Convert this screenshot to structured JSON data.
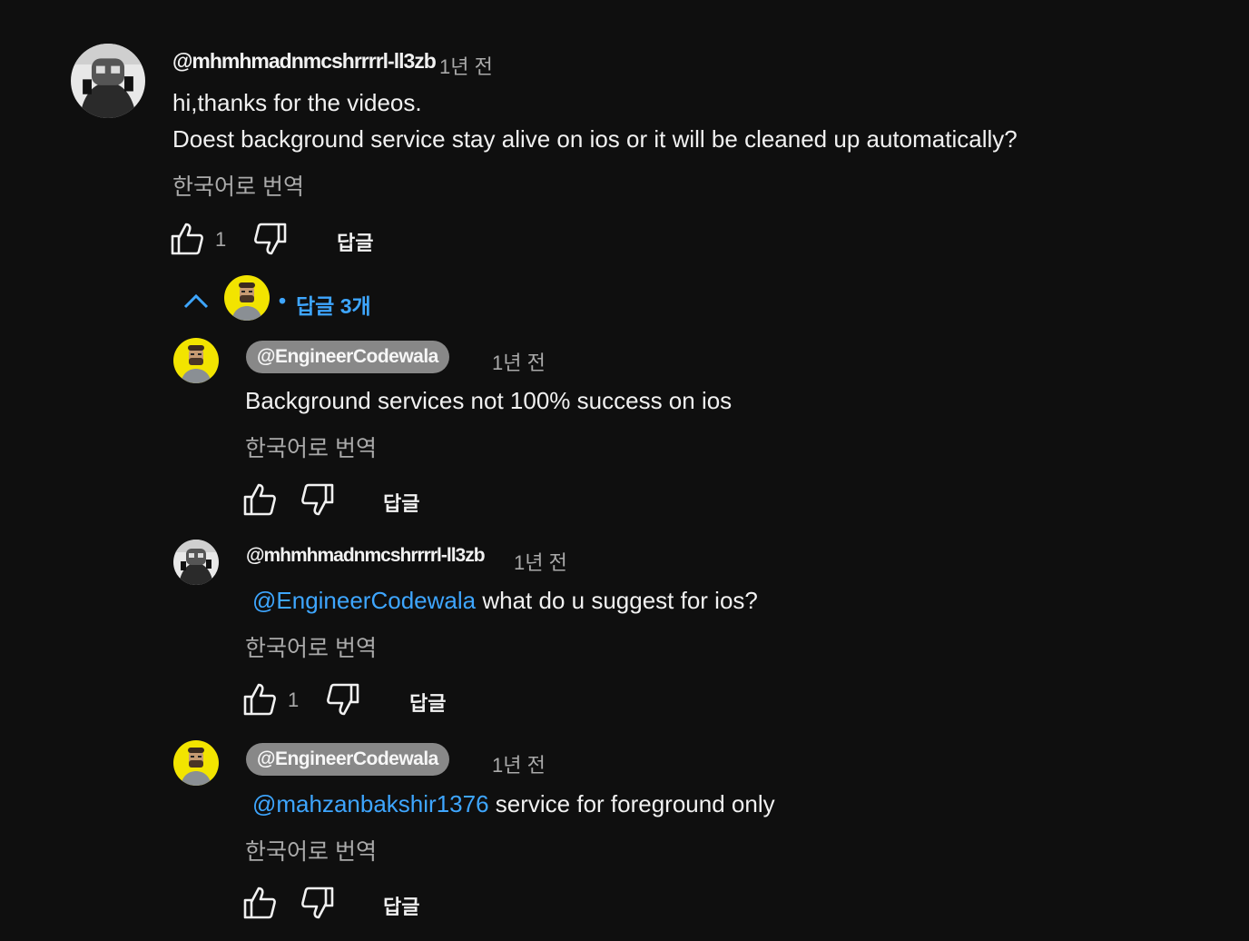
{
  "top_comment": {
    "author": "@mhmhmadnmcshrrrrl-ll3zb",
    "time": "1년 전",
    "lines": [
      "hi,thanks for the videos.",
      "Doest background service stay alive on ios or it will be cleaned up automatically?"
    ],
    "translate": "한국어로 번역",
    "likes": "1",
    "reply_label": "답글"
  },
  "replies_toggle": {
    "separator": "•",
    "label": "답글 3개"
  },
  "replies": [
    {
      "author": "@EngineerCodewala",
      "time": "1년 전",
      "mention": "",
      "text": "Background services not 100% success on ios",
      "translate": "한국어로 번역",
      "likes": "",
      "reply_label": "답글"
    },
    {
      "author": "@mhmhmadnmcshrrrrl-ll3zb",
      "time": "1년 전",
      "mention": "@EngineerCodewala",
      "text": "what do u suggest for ios?",
      "translate": "한국어로 번역",
      "likes": "1",
      "reply_label": "답글"
    },
    {
      "author": "@EngineerCodewala",
      "time": "1년 전",
      "mention": "@mahzanbakshir1376",
      "text": "service for foreground only",
      "translate": "한국어로 번역",
      "likes": "",
      "reply_label": "답글"
    }
  ],
  "icons": {
    "like": "thumbs-up-icon",
    "dislike": "thumbs-down-icon",
    "collapse": "chevron-up-icon"
  },
  "colors": {
    "background": "#0f0f0f",
    "link": "#3ea6ff",
    "secondary_text": "#aaaaaa",
    "chip": "#888888",
    "avatar_yellow": "#f2e400"
  }
}
